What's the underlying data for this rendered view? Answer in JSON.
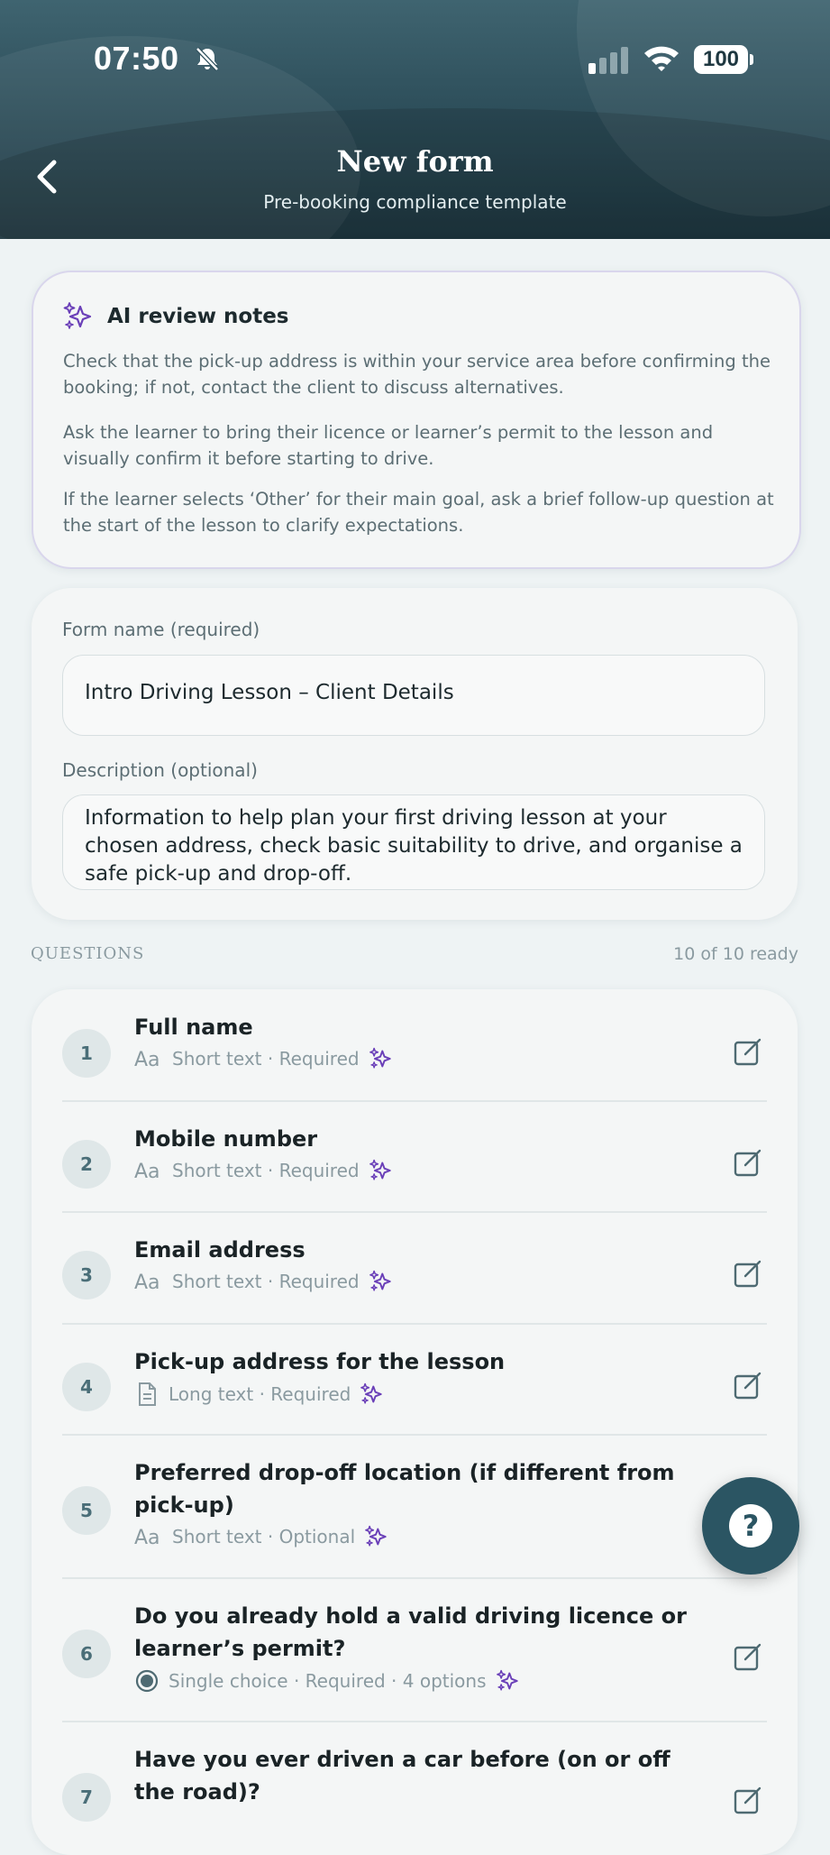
{
  "status_bar": {
    "time": "07:50",
    "battery": "100"
  },
  "nav": {
    "title": "New form",
    "subtitle": "Pre-booking compliance template"
  },
  "ai_notes": {
    "title": "AI review notes",
    "paragraphs": [
      "Check that the pick-up address is within your service area before confirming the booking; if not, contact the client to discuss alternatives.",
      "Ask the learner to bring their licence or learner’s permit to the lesson and visually confirm it before starting to drive.",
      "If the learner selects ‘Other’ for their main goal, ask a brief follow-up question at the start of the lesson to clarify expectations."
    ]
  },
  "form": {
    "name_label": "Form name (required)",
    "name_value": "Intro Driving Lesson – Client Details",
    "desc_label": "Description (optional)",
    "desc_value": "Information to help plan your first driving lesson at your chosen address, check basic suitability to drive, and organise a safe pick-up and drop-off."
  },
  "questions_section": {
    "heading": "QUESTIONS",
    "count": "10 of 10 ready"
  },
  "questions": [
    {
      "num": "1",
      "title": "Full name",
      "type_icon": "text-icon",
      "meta": "Short text · Required"
    },
    {
      "num": "2",
      "title": "Mobile number",
      "type_icon": "text-icon",
      "meta": "Short text · Required"
    },
    {
      "num": "3",
      "title": "Email address",
      "type_icon": "text-icon",
      "meta": "Short text · Required"
    },
    {
      "num": "4",
      "title": "Pick-up address for the lesson",
      "type_icon": "document-icon",
      "meta": "Long text · Required"
    },
    {
      "num": "5",
      "title": "Preferred drop-off location (if different from pick-up)",
      "type_icon": "text-icon",
      "meta": "Short text · Optional"
    },
    {
      "num": "6",
      "title": "Do you already hold a valid driving licence or learner’s permit?",
      "type_icon": "radio-icon",
      "meta": "Single choice · Required · 4 options"
    },
    {
      "num": "7",
      "title": "Have you ever driven a car before (on or off the road)?",
      "type_icon": "radio-icon",
      "meta": ""
    }
  ],
  "help_button": {
    "label": "?"
  },
  "colors": {
    "header": "#2e4f5b",
    "accent": "#6a3fb8",
    "fab": "#2b5563"
  }
}
